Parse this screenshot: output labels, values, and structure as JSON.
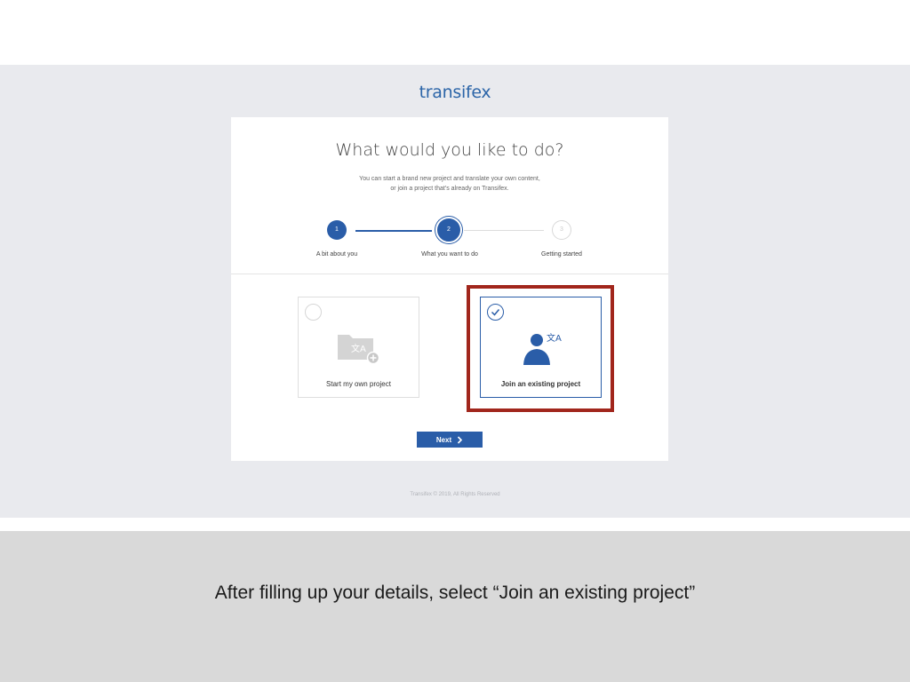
{
  "header": {
    "logo": "transifex"
  },
  "card": {
    "title": "What would you like to do?",
    "subtitle_line1": "You can start a brand new project and translate your own content,",
    "subtitle_line2": "or join a project that's already on Transifex."
  },
  "steps": [
    {
      "number": "1",
      "label": "A bit about you",
      "state": "done"
    },
    {
      "number": "2",
      "label": "What you want to do",
      "state": "current"
    },
    {
      "number": "3",
      "label": "Getting started",
      "state": "pending"
    }
  ],
  "options": [
    {
      "label": "Start my own project",
      "icon": "folder-translate-add-icon",
      "selected": false
    },
    {
      "label": "Join an existing project",
      "icon": "person-translate-icon",
      "selected": true
    }
  ],
  "next_button": {
    "label": "Next"
  },
  "footer": "Transifex © 2019, All Rights Reserved",
  "caption": "After filling up your details, select “Join an existing project”",
  "colors": {
    "brand": "#2a5da8",
    "highlight": "#a1261c",
    "background": "#e9eaee"
  }
}
